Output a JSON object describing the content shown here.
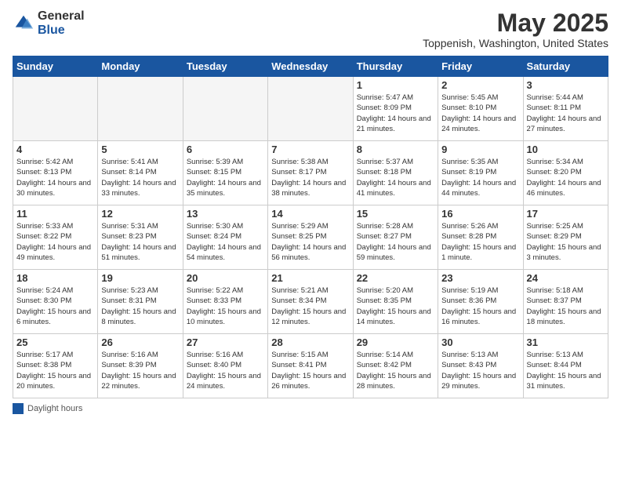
{
  "logo": {
    "general": "General",
    "blue": "Blue"
  },
  "title": "May 2025",
  "subtitle": "Toppenish, Washington, United States",
  "days_of_week": [
    "Sunday",
    "Monday",
    "Tuesday",
    "Wednesday",
    "Thursday",
    "Friday",
    "Saturday"
  ],
  "footer": {
    "daylight_label": "Daylight hours"
  },
  "weeks": [
    [
      {
        "day": "",
        "info": ""
      },
      {
        "day": "",
        "info": ""
      },
      {
        "day": "",
        "info": ""
      },
      {
        "day": "",
        "info": ""
      },
      {
        "day": "1",
        "info": "Sunrise: 5:47 AM\nSunset: 8:09 PM\nDaylight: 14 hours\nand 21 minutes."
      },
      {
        "day": "2",
        "info": "Sunrise: 5:45 AM\nSunset: 8:10 PM\nDaylight: 14 hours\nand 24 minutes."
      },
      {
        "day": "3",
        "info": "Sunrise: 5:44 AM\nSunset: 8:11 PM\nDaylight: 14 hours\nand 27 minutes."
      }
    ],
    [
      {
        "day": "4",
        "info": "Sunrise: 5:42 AM\nSunset: 8:13 PM\nDaylight: 14 hours\nand 30 minutes."
      },
      {
        "day": "5",
        "info": "Sunrise: 5:41 AM\nSunset: 8:14 PM\nDaylight: 14 hours\nand 33 minutes."
      },
      {
        "day": "6",
        "info": "Sunrise: 5:39 AM\nSunset: 8:15 PM\nDaylight: 14 hours\nand 35 minutes."
      },
      {
        "day": "7",
        "info": "Sunrise: 5:38 AM\nSunset: 8:17 PM\nDaylight: 14 hours\nand 38 minutes."
      },
      {
        "day": "8",
        "info": "Sunrise: 5:37 AM\nSunset: 8:18 PM\nDaylight: 14 hours\nand 41 minutes."
      },
      {
        "day": "9",
        "info": "Sunrise: 5:35 AM\nSunset: 8:19 PM\nDaylight: 14 hours\nand 44 minutes."
      },
      {
        "day": "10",
        "info": "Sunrise: 5:34 AM\nSunset: 8:20 PM\nDaylight: 14 hours\nand 46 minutes."
      }
    ],
    [
      {
        "day": "11",
        "info": "Sunrise: 5:33 AM\nSunset: 8:22 PM\nDaylight: 14 hours\nand 49 minutes."
      },
      {
        "day": "12",
        "info": "Sunrise: 5:31 AM\nSunset: 8:23 PM\nDaylight: 14 hours\nand 51 minutes."
      },
      {
        "day": "13",
        "info": "Sunrise: 5:30 AM\nSunset: 8:24 PM\nDaylight: 14 hours\nand 54 minutes."
      },
      {
        "day": "14",
        "info": "Sunrise: 5:29 AM\nSunset: 8:25 PM\nDaylight: 14 hours\nand 56 minutes."
      },
      {
        "day": "15",
        "info": "Sunrise: 5:28 AM\nSunset: 8:27 PM\nDaylight: 14 hours\nand 59 minutes."
      },
      {
        "day": "16",
        "info": "Sunrise: 5:26 AM\nSunset: 8:28 PM\nDaylight: 15 hours\nand 1 minute."
      },
      {
        "day": "17",
        "info": "Sunrise: 5:25 AM\nSunset: 8:29 PM\nDaylight: 15 hours\nand 3 minutes."
      }
    ],
    [
      {
        "day": "18",
        "info": "Sunrise: 5:24 AM\nSunset: 8:30 PM\nDaylight: 15 hours\nand 6 minutes."
      },
      {
        "day": "19",
        "info": "Sunrise: 5:23 AM\nSunset: 8:31 PM\nDaylight: 15 hours\nand 8 minutes."
      },
      {
        "day": "20",
        "info": "Sunrise: 5:22 AM\nSunset: 8:33 PM\nDaylight: 15 hours\nand 10 minutes."
      },
      {
        "day": "21",
        "info": "Sunrise: 5:21 AM\nSunset: 8:34 PM\nDaylight: 15 hours\nand 12 minutes."
      },
      {
        "day": "22",
        "info": "Sunrise: 5:20 AM\nSunset: 8:35 PM\nDaylight: 15 hours\nand 14 minutes."
      },
      {
        "day": "23",
        "info": "Sunrise: 5:19 AM\nSunset: 8:36 PM\nDaylight: 15 hours\nand 16 minutes."
      },
      {
        "day": "24",
        "info": "Sunrise: 5:18 AM\nSunset: 8:37 PM\nDaylight: 15 hours\nand 18 minutes."
      }
    ],
    [
      {
        "day": "25",
        "info": "Sunrise: 5:17 AM\nSunset: 8:38 PM\nDaylight: 15 hours\nand 20 minutes."
      },
      {
        "day": "26",
        "info": "Sunrise: 5:16 AM\nSunset: 8:39 PM\nDaylight: 15 hours\nand 22 minutes."
      },
      {
        "day": "27",
        "info": "Sunrise: 5:16 AM\nSunset: 8:40 PM\nDaylight: 15 hours\nand 24 minutes."
      },
      {
        "day": "28",
        "info": "Sunrise: 5:15 AM\nSunset: 8:41 PM\nDaylight: 15 hours\nand 26 minutes."
      },
      {
        "day": "29",
        "info": "Sunrise: 5:14 AM\nSunset: 8:42 PM\nDaylight: 15 hours\nand 28 minutes."
      },
      {
        "day": "30",
        "info": "Sunrise: 5:13 AM\nSunset: 8:43 PM\nDaylight: 15 hours\nand 29 minutes."
      },
      {
        "day": "31",
        "info": "Sunrise: 5:13 AM\nSunset: 8:44 PM\nDaylight: 15 hours\nand 31 minutes."
      }
    ]
  ]
}
